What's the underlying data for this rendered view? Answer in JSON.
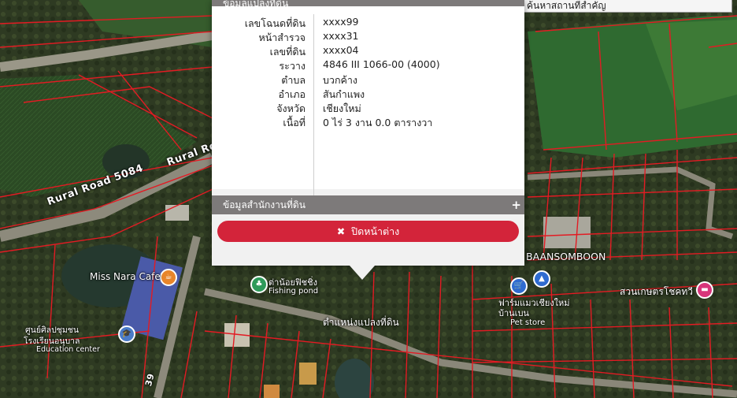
{
  "popup": {
    "title": "ข้อมูลแปลงที่ดิน",
    "rows": [
      {
        "label": "เลขโฉนดที่ดิน",
        "value": "xxxx99"
      },
      {
        "label": "หน้าสำรวจ",
        "value": "xxxx31"
      },
      {
        "label": "เลขที่ดิน",
        "value": "xxxx04"
      },
      {
        "label": "ระวาง",
        "value": "4846 III 1066-00 (4000)"
      },
      {
        "label": "ตำบล",
        "value": "บวกค้าง"
      },
      {
        "label": "อำเภอ",
        "value": "สันกำแพง"
      },
      {
        "label": "จังหวัด",
        "value": "เชียงใหม่"
      },
      {
        "label": "เนื้อที่",
        "value": "0 ไร่ 3 งาน 0.0 ตารางวา"
      }
    ],
    "land_office_header": "ข้อมูลสำนักงานที่ดิน",
    "expand_symbol": "+",
    "close_label": "ปิดหน้าต่าง",
    "close_icon": "✖"
  },
  "search": {
    "placeholder": "ค้นหาสถานที่สำคัญ"
  },
  "map": {
    "road_label_1": "Rural Road 5084",
    "road_label_2": "Rural Road",
    "road_number": "39",
    "poi": [
      {
        "name": "Miss Nara Cafe",
        "icon": "cafe-icon"
      },
      {
        "name": "ต่าน้อยฟิชชิ่ง",
        "icon": "park-icon"
      },
      {
        "name": "Fishing pond",
        "icon": "park-icon"
      },
      {
        "name": "ศูนย์ศิลปชุมชน",
        "icon": "school-icon"
      },
      {
        "name": "โรงเรียนอนุบาล",
        "icon": "school-icon"
      },
      {
        "name": "Education center",
        "icon": "school-icon"
      },
      {
        "name": "BAANSOMBOON",
        "icon": "shop-icon"
      },
      {
        "name": "สวนเกษตรโชคทวี",
        "icon": "hotel-icon"
      },
      {
        "name": "ฟาร์มแมวเชียงใหม่ บ้านเบน",
        "icon": "shop-icon"
      },
      {
        "name": "Pet store",
        "icon": "shop-icon"
      }
    ],
    "parcel_marker_label": "ตำแหน่งแปลงที่ดิน",
    "colors": {
      "parcel_line": "#e31b23",
      "close_button": "#d3243a",
      "section_header": "#7d7a7a"
    }
  }
}
